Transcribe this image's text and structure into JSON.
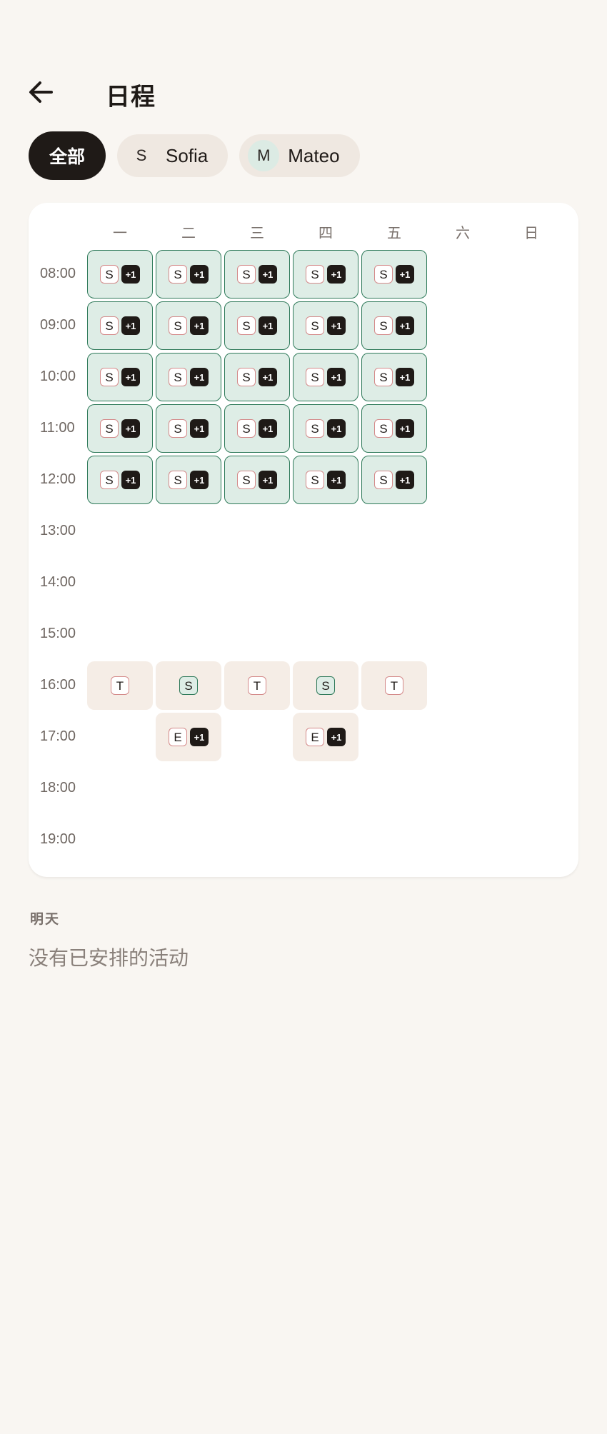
{
  "header": {
    "back_icon": "arrow-left-icon",
    "title": "日程"
  },
  "filters": {
    "all_label": "全部",
    "people": [
      {
        "initial": "S",
        "name": "Sofia"
      },
      {
        "initial": "M",
        "name": "Mateo"
      }
    ]
  },
  "calendar": {
    "days": [
      "一",
      "二",
      "三",
      "四",
      "五",
      "六",
      "日"
    ],
    "times": [
      "08:00",
      "09:00",
      "10:00",
      "11:00",
      "12:00",
      "13:00",
      "14:00",
      "15:00",
      "16:00",
      "17:00",
      "18:00",
      "19:00"
    ],
    "events": [
      {
        "day": 0,
        "slot": 0,
        "style": "green",
        "letter": "S",
        "more": "+1"
      },
      {
        "day": 1,
        "slot": 0,
        "style": "green",
        "letter": "S",
        "more": "+1"
      },
      {
        "day": 2,
        "slot": 0,
        "style": "green",
        "letter": "S",
        "more": "+1"
      },
      {
        "day": 3,
        "slot": 0,
        "style": "green",
        "letter": "S",
        "more": "+1"
      },
      {
        "day": 4,
        "slot": 0,
        "style": "green",
        "letter": "S",
        "more": "+1"
      },
      {
        "day": 0,
        "slot": 1,
        "style": "green",
        "letter": "S",
        "more": "+1"
      },
      {
        "day": 1,
        "slot": 1,
        "style": "green",
        "letter": "S",
        "more": "+1"
      },
      {
        "day": 2,
        "slot": 1,
        "style": "green",
        "letter": "S",
        "more": "+1"
      },
      {
        "day": 3,
        "slot": 1,
        "style": "green",
        "letter": "S",
        "more": "+1"
      },
      {
        "day": 4,
        "slot": 1,
        "style": "green",
        "letter": "S",
        "more": "+1"
      },
      {
        "day": 0,
        "slot": 2,
        "style": "green",
        "letter": "S",
        "more": "+1"
      },
      {
        "day": 1,
        "slot": 2,
        "style": "green",
        "letter": "S",
        "more": "+1"
      },
      {
        "day": 2,
        "slot": 2,
        "style": "green",
        "letter": "S",
        "more": "+1"
      },
      {
        "day": 3,
        "slot": 2,
        "style": "green",
        "letter": "S",
        "more": "+1"
      },
      {
        "day": 4,
        "slot": 2,
        "style": "green",
        "letter": "S",
        "more": "+1"
      },
      {
        "day": 0,
        "slot": 3,
        "style": "green",
        "letter": "S",
        "more": "+1"
      },
      {
        "day": 1,
        "slot": 3,
        "style": "green",
        "letter": "S",
        "more": "+1"
      },
      {
        "day": 2,
        "slot": 3,
        "style": "green",
        "letter": "S",
        "more": "+1"
      },
      {
        "day": 3,
        "slot": 3,
        "style": "green",
        "letter": "S",
        "more": "+1"
      },
      {
        "day": 4,
        "slot": 3,
        "style": "green",
        "letter": "S",
        "more": "+1"
      },
      {
        "day": 0,
        "slot": 4,
        "style": "green",
        "letter": "S",
        "more": "+1"
      },
      {
        "day": 1,
        "slot": 4,
        "style": "green",
        "letter": "S",
        "more": "+1"
      },
      {
        "day": 2,
        "slot": 4,
        "style": "green",
        "letter": "S",
        "more": "+1"
      },
      {
        "day": 3,
        "slot": 4,
        "style": "green",
        "letter": "S",
        "more": "+1"
      },
      {
        "day": 4,
        "slot": 4,
        "style": "green",
        "letter": "S",
        "more": "+1"
      },
      {
        "day": 0,
        "slot": 8,
        "style": "beige",
        "letter": "T",
        "letter_style": "red"
      },
      {
        "day": 1,
        "slot": 8,
        "style": "beige",
        "letter": "S",
        "letter_style": "green"
      },
      {
        "day": 2,
        "slot": 8,
        "style": "beige",
        "letter": "T",
        "letter_style": "red"
      },
      {
        "day": 3,
        "slot": 8,
        "style": "beige",
        "letter": "S",
        "letter_style": "green"
      },
      {
        "day": 4,
        "slot": 8,
        "style": "beige",
        "letter": "T",
        "letter_style": "red"
      },
      {
        "day": 1,
        "slot": 9,
        "style": "beige",
        "letter": "E",
        "more": "+1"
      },
      {
        "day": 3,
        "slot": 9,
        "style": "beige",
        "letter": "E",
        "more": "+1"
      }
    ]
  },
  "tomorrow": {
    "label": "明天",
    "empty_message": "没有已安排的活动"
  },
  "colors": {
    "background": "#f9f6f2",
    "event_green": "#deede6",
    "event_green_border": "#2f7a5a",
    "event_beige": "#f5ede6",
    "badge_dark": "#1f1a17",
    "badge_red_border": "#d48a8a"
  }
}
